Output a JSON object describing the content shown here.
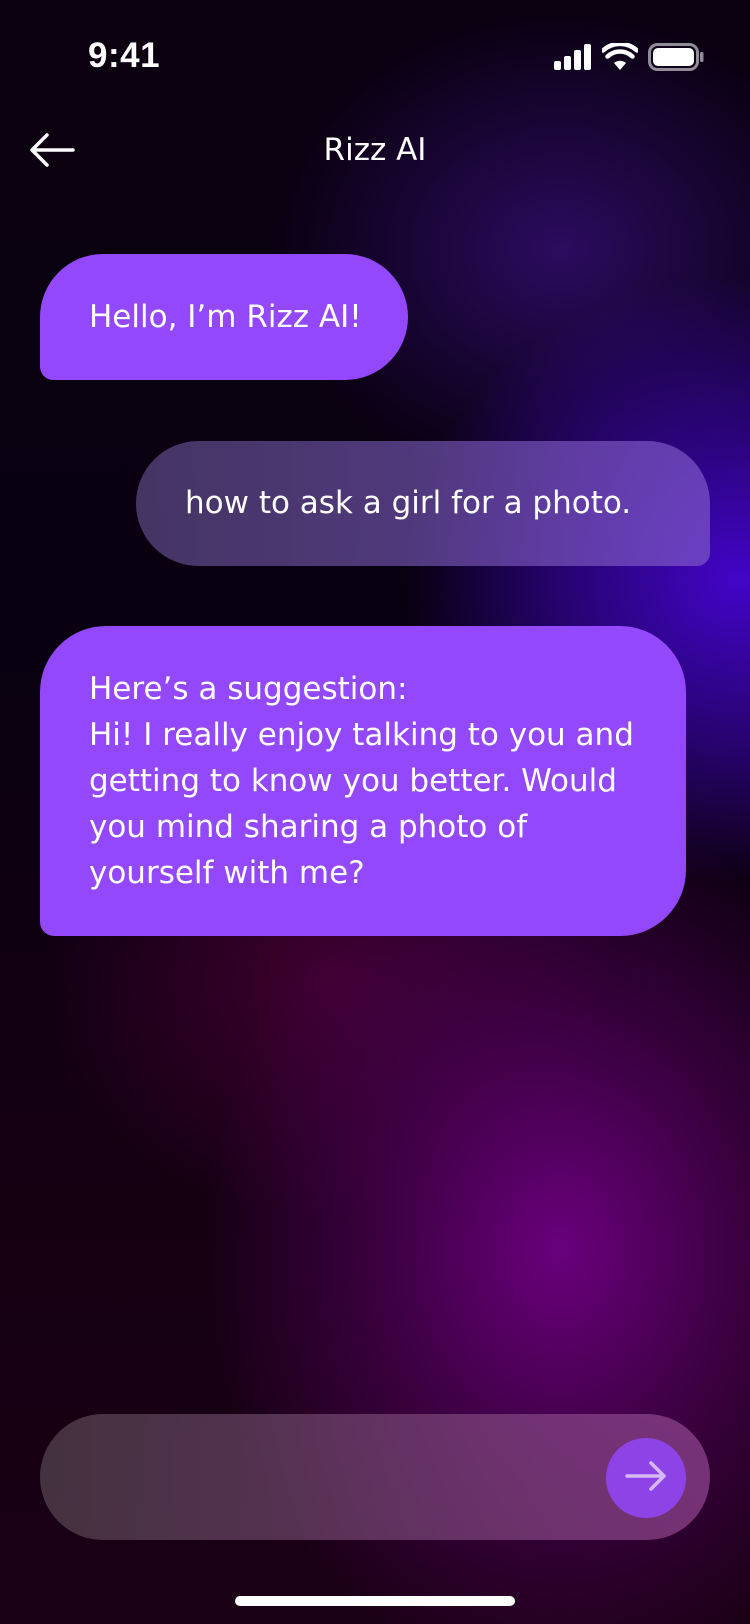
{
  "status_bar": {
    "time": "9:41",
    "icons": [
      "cellular-signal-icon",
      "wifi-icon",
      "battery-icon"
    ]
  },
  "header": {
    "back_icon": "arrow-left-icon",
    "title": "Rizz AI"
  },
  "messages": [
    {
      "sender": "ai",
      "text": "Hello, I’m Rizz AI!"
    },
    {
      "sender": "user",
      "text": "how to ask a girl for a photo."
    },
    {
      "sender": "ai",
      "text": "Here’s a suggestion:\nHi! I really enjoy talking to you and getting to know you better. Would you mind sharing a photo of yourself with me?"
    }
  ],
  "composer": {
    "value": "",
    "placeholder": "",
    "send_icon": "arrow-right-icon"
  },
  "colors": {
    "ai_bubble": "#9448fb",
    "send_button": "#8e43e6",
    "text": "#ffffff"
  }
}
